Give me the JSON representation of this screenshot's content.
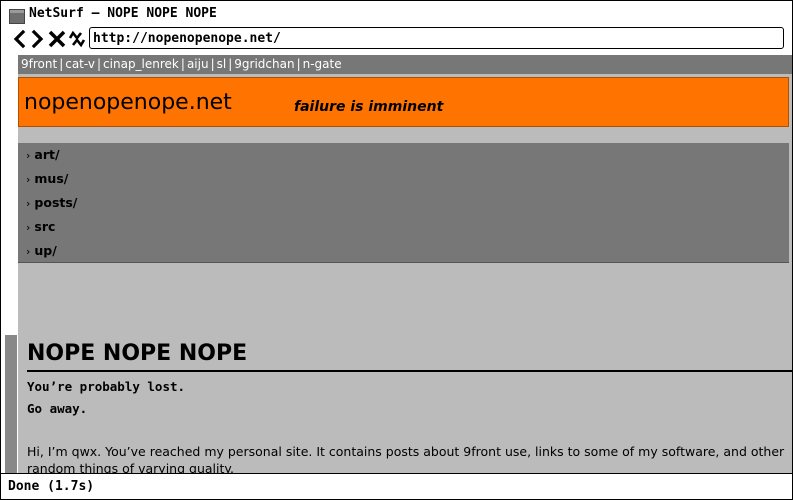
{
  "window": {
    "title": "NetSurf — NOPE NOPE NOPE"
  },
  "navigation": {
    "back_icon": "chevron-left-icon",
    "forward_icon": "chevron-right-icon",
    "stop_icon": "close-icon",
    "reload_icon": "reload-icon",
    "url": "http://nopenopenope.net/"
  },
  "page": {
    "top_links": [
      "9front",
      "cat-v",
      "cinap_lenrek",
      "aiju",
      "sl",
      "9gridchan",
      "n-gate"
    ],
    "top_links_separator": "|",
    "site_title": "nopenopenope.net",
    "tagline": "failure is imminent",
    "menu_arrow": "›",
    "menu": [
      "art/",
      "mus/",
      "posts/",
      "src",
      "up/"
    ],
    "heading": "NOPE NOPE NOPE",
    "lost_lines": [
      "You’re probably lost.",
      "Go away."
    ],
    "intro": "Hi, I’m qwx. You’ve reached my personal site. It contains posts about 9front use, links to some of my software, and other random things of varying quality.",
    "colors": {
      "header_bg": "#ff7300",
      "nav_bg": "#777777",
      "page_bg": "#bbbbbb"
    }
  },
  "status": {
    "text": "Done (1.7s)"
  }
}
